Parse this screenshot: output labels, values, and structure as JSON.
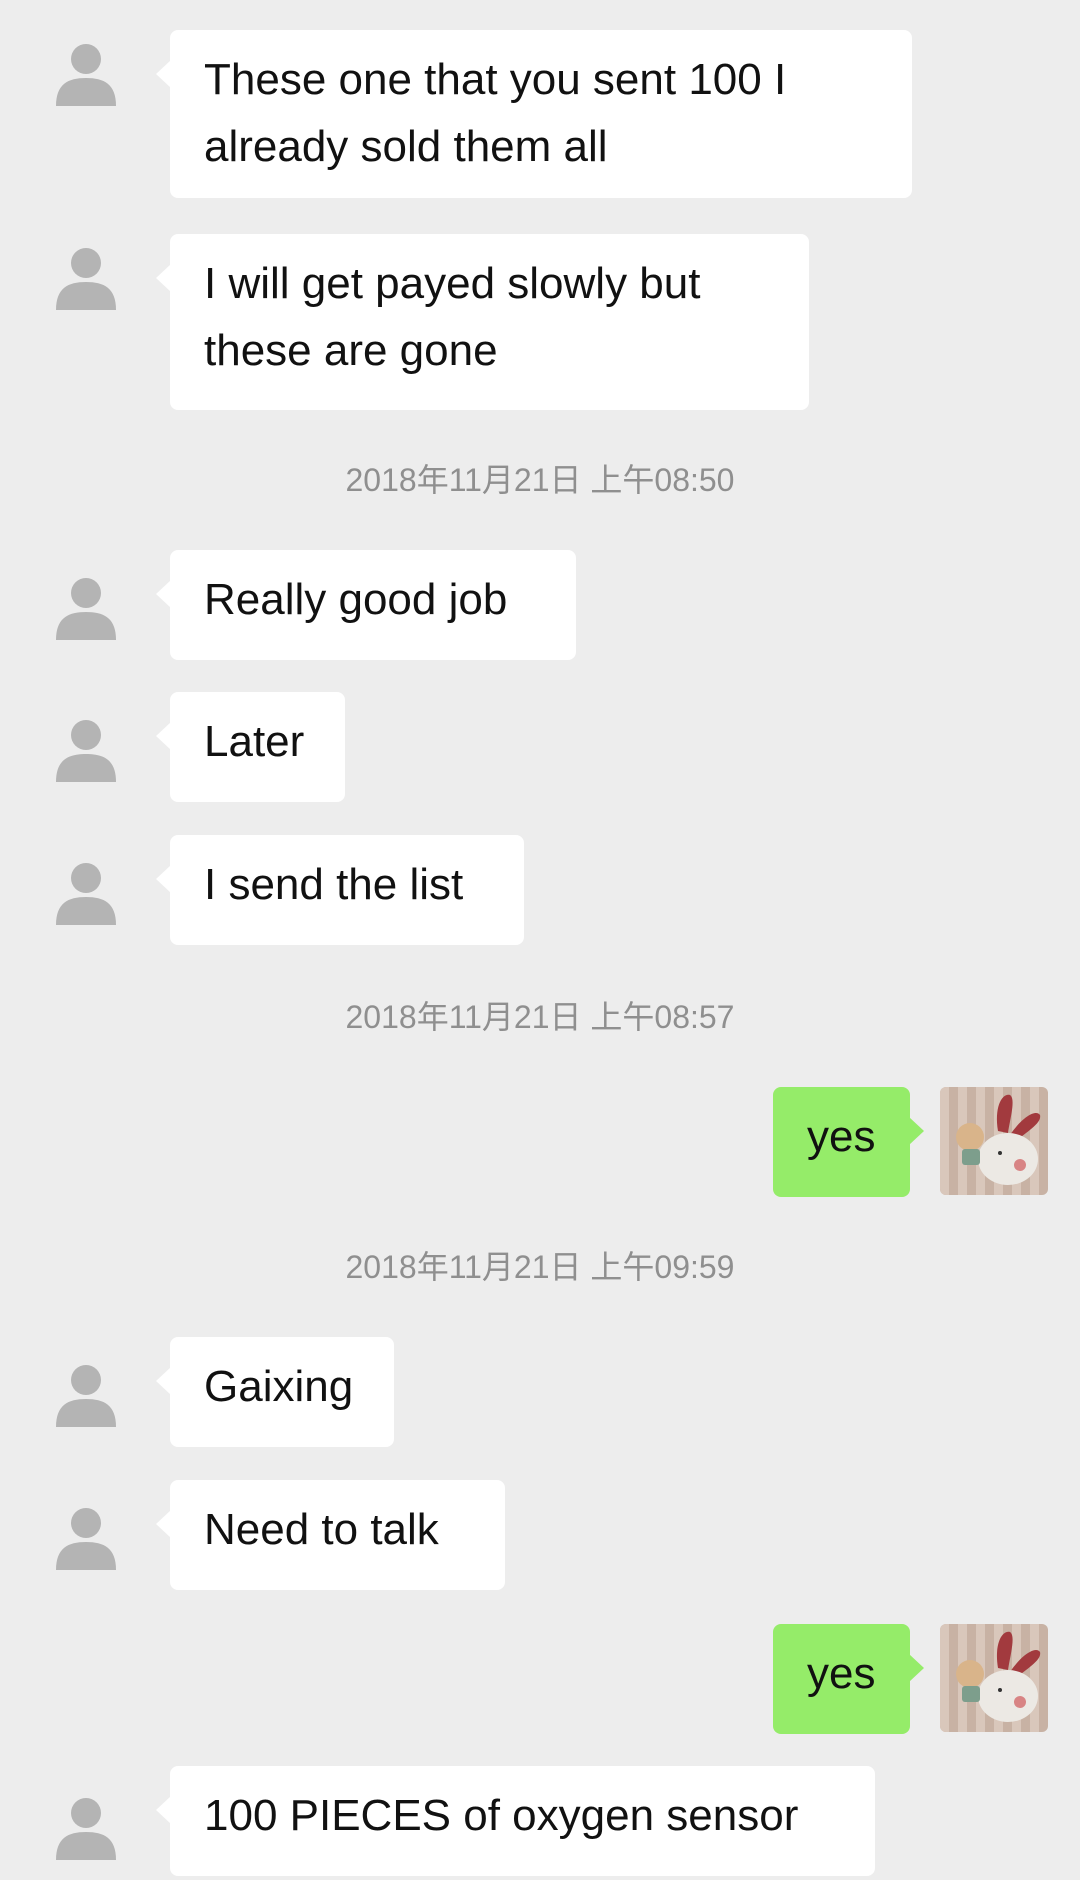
{
  "messages": [
    {
      "from": "other",
      "text": "These one that you sent 100 I\nalready sold them all"
    },
    {
      "from": "other",
      "text": "I will get payed slowly but\nthese are gone"
    },
    {
      "type": "timestamp",
      "text": "2018年11月21日 上午08:50"
    },
    {
      "from": "other",
      "text": "Really good job"
    },
    {
      "from": "other",
      "text": "Later"
    },
    {
      "from": "other",
      "text": "I send the list"
    },
    {
      "type": "timestamp",
      "text": "2018年11月21日 上午08:57"
    },
    {
      "from": "me",
      "text": "yes"
    },
    {
      "type": "timestamp",
      "text": "2018年11月21日 上午09:59"
    },
    {
      "from": "other",
      "text": "Gaixing"
    },
    {
      "from": "other",
      "text": "Need to talk"
    },
    {
      "from": "me",
      "text": "yes"
    },
    {
      "from": "other",
      "text": "100 PIECES of oxygen sensor"
    }
  ],
  "colors": {
    "background": "#ededed",
    "incoming_bubble": "#ffffff",
    "outgoing_bubble": "#95ec69",
    "timestamp_text": "#8f8f8f",
    "default_avatar": "#b4b4b4"
  },
  "icons": {
    "other_avatar": "default-user-avatar-icon",
    "my_avatar": "bunny-and-bear-sticker-avatar"
  }
}
